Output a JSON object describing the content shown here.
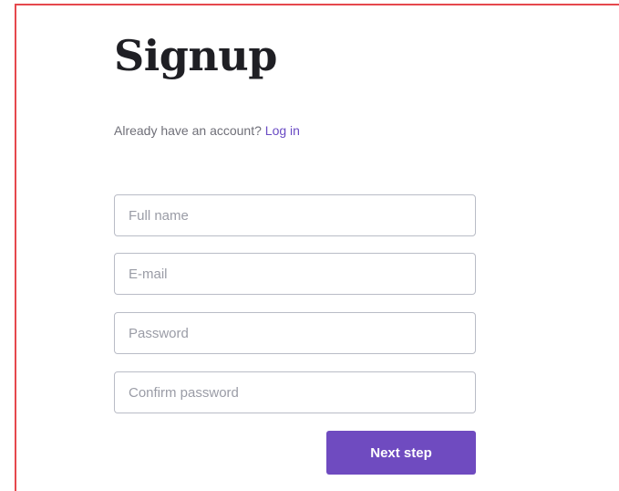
{
  "signup": {
    "title": "Signup",
    "login_prompt": "Already have an account?",
    "login_link": "Log in",
    "fields": {
      "full_name": {
        "placeholder": "Full name",
        "value": ""
      },
      "email": {
        "placeholder": "E-mail",
        "value": ""
      },
      "password": {
        "placeholder": "Password",
        "value": ""
      },
      "confirm_password": {
        "placeholder": "Confirm password",
        "value": ""
      }
    },
    "next_button": "Next step"
  },
  "colors": {
    "accent": "#6f4bc0",
    "link": "#6a4bc4",
    "frame_border": "#e5484d"
  }
}
